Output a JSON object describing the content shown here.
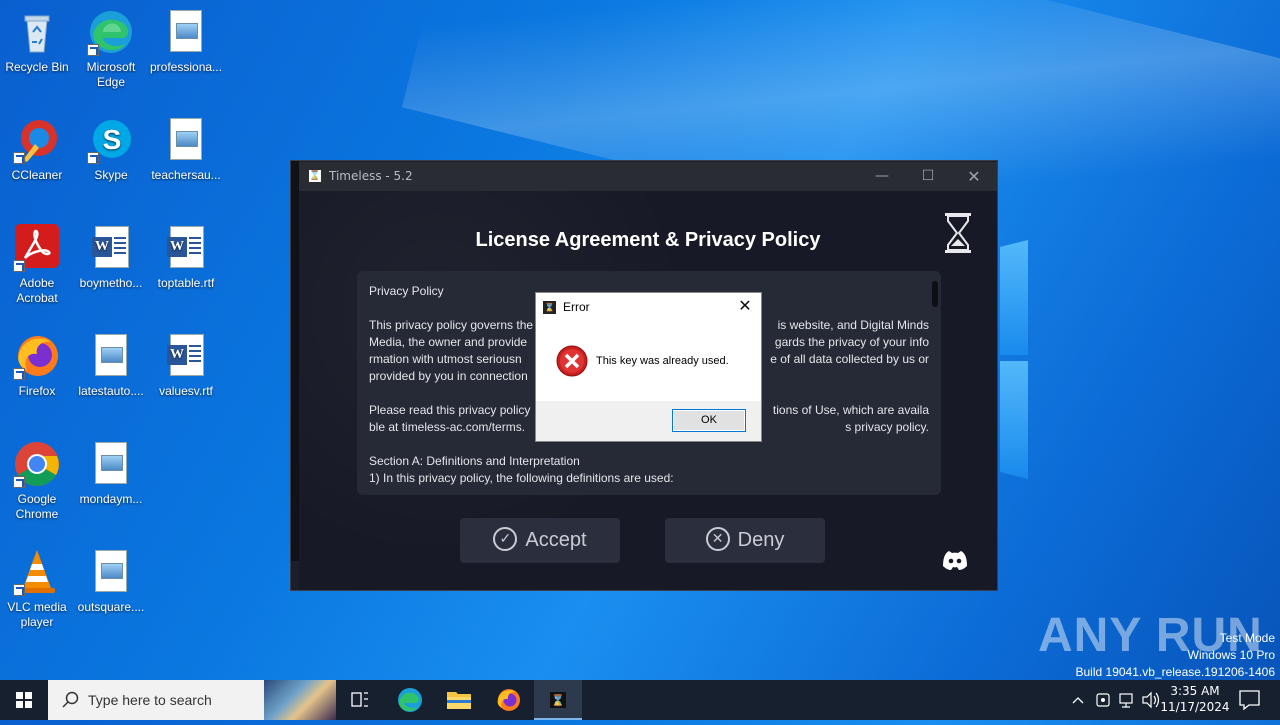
{
  "desktop": {
    "icons": [
      {
        "label": "Recycle Bin"
      },
      {
        "label": "Microsoft Edge"
      },
      {
        "label": "professiona..."
      },
      {
        "label": "CCleaner"
      },
      {
        "label": "Skype"
      },
      {
        "label": "teachersau..."
      },
      {
        "label": "Adobe Acrobat"
      },
      {
        "label": "boymetho..."
      },
      {
        "label": "toptable.rtf"
      },
      {
        "label": "Firefox"
      },
      {
        "label": "latestauto...."
      },
      {
        "label": "valuesv.rtf"
      },
      {
        "label": "Google Chrome"
      },
      {
        "label": "mondaym..."
      },
      {
        "label": "VLC media player"
      },
      {
        "label": "outsquare...."
      }
    ]
  },
  "app": {
    "title": "Timeless - 5.2",
    "heading": "License Agreement &  Privacy Policy",
    "policy": {
      "heading": "Privacy Policy",
      "p1": "This privacy policy governs the use of this website, and Digital Minds Media, the owner and provider of this website, regards the privacy of your information with utmost seriousness. This privacy policy describes the use of all data collected by us or provided by you in connection with this website.",
      "p1_visible_a": "This privacy policy governs the",
      "p1_visible_b": "is website, and Digital Minds",
      "p2_visible_a": "Media, the owner and provide",
      "p2_visible_b": "gards the privacy of your info",
      "p3_visible_a": "rmation with utmost seriousn",
      "p3_visible_b": "e of all data collected by us or",
      "p4_visible_a": "provided by you in connection",
      "p5_visible_a": "Please read this privacy policy",
      "p5_visible_b": "tions of Use, which are availa",
      "p6_visible_a": "ble at timeless-ac.com/terms.",
      "p6_visible_b": "s privacy policy.",
      "section": "Section A: Definitions and Interpretation",
      "item1": "1) In this privacy policy, the following definitions are used:"
    },
    "accept_label": "Accept",
    "deny_label": "Deny"
  },
  "error_dialog": {
    "title": "Error",
    "message": "This key was already used.",
    "ok_label": "OK"
  },
  "taskbar": {
    "search_placeholder": "Type here to search",
    "time": "3:35 AM",
    "date": "11/17/2024"
  },
  "watermark": {
    "brand": "ANY RUN",
    "line1": "Test Mode",
    "line2": "Windows 10 Pro",
    "line3": "Build 19041.vb_release.191206-1406"
  }
}
